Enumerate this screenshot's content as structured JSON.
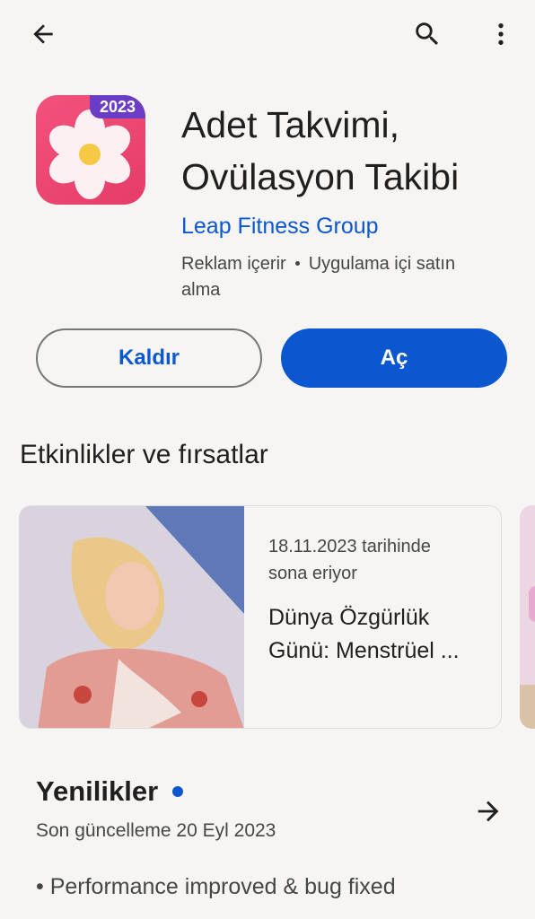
{
  "topbar": {
    "back_icon": "arrow-left-icon",
    "search_icon": "search-icon",
    "more_icon": "more-vert-icon"
  },
  "app": {
    "badge_year": "2023",
    "title_line1": "Adet Takvimi,",
    "title_line2": "Ovülasyon Takibi",
    "developer": "Leap Fitness Group",
    "meta_ads": "Reklam içerir",
    "meta_iap_line1": "Uygulama içi satın",
    "meta_iap_line2": "alma"
  },
  "actions": {
    "uninstall": "Kaldır",
    "open": "Aç"
  },
  "events": {
    "section_title": "Etkinlikler ve fırsatlar",
    "card": {
      "date_line1": "18.11.2023 tarihinde",
      "date_line2": "sona eriyor",
      "title_line1": "Dünya Özgürlük",
      "title_line2": "Günü: Menstrüel ..."
    }
  },
  "whats_new": {
    "title": "Yenilikler",
    "updated": "Son güncelleme 20 Eyl 2023",
    "note": "• Performance improved & bug fixed"
  },
  "colors": {
    "accent": "#0b57d0",
    "icon_pink": "#e63c69",
    "badge_purple": "#6a3dc4",
    "background": "#f7f5f3"
  }
}
